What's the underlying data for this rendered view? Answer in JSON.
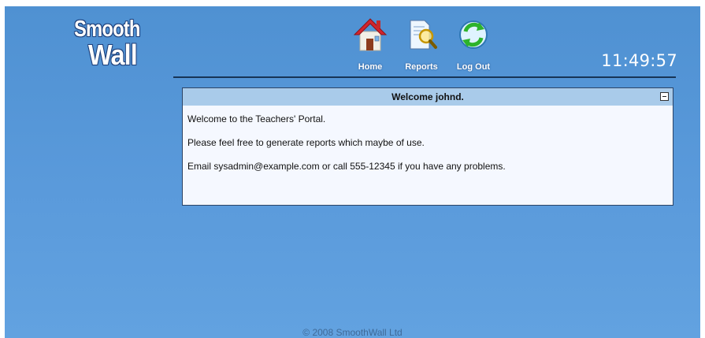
{
  "logo": {
    "line1": "Smooth",
    "line2": "Wall"
  },
  "nav": [
    {
      "label": "Home",
      "icon": "home-icon"
    },
    {
      "label": "Reports",
      "icon": "reports-icon"
    },
    {
      "label": "Log Out",
      "icon": "logout-icon"
    }
  ],
  "clock": "11:49:57",
  "panel": {
    "title": "Welcome johnd.",
    "lines": [
      "Welcome to the Teachers' Portal.",
      "Please feel free to generate reports which maybe of use.",
      "Email sysadmin@example.com or call 555-12345 if you have any problems."
    ]
  },
  "footer": "© 2008 SmoothWall Ltd",
  "colors": {
    "background": "#5a9adb",
    "panel_header": "#a9cbea",
    "divider": "#173456"
  }
}
